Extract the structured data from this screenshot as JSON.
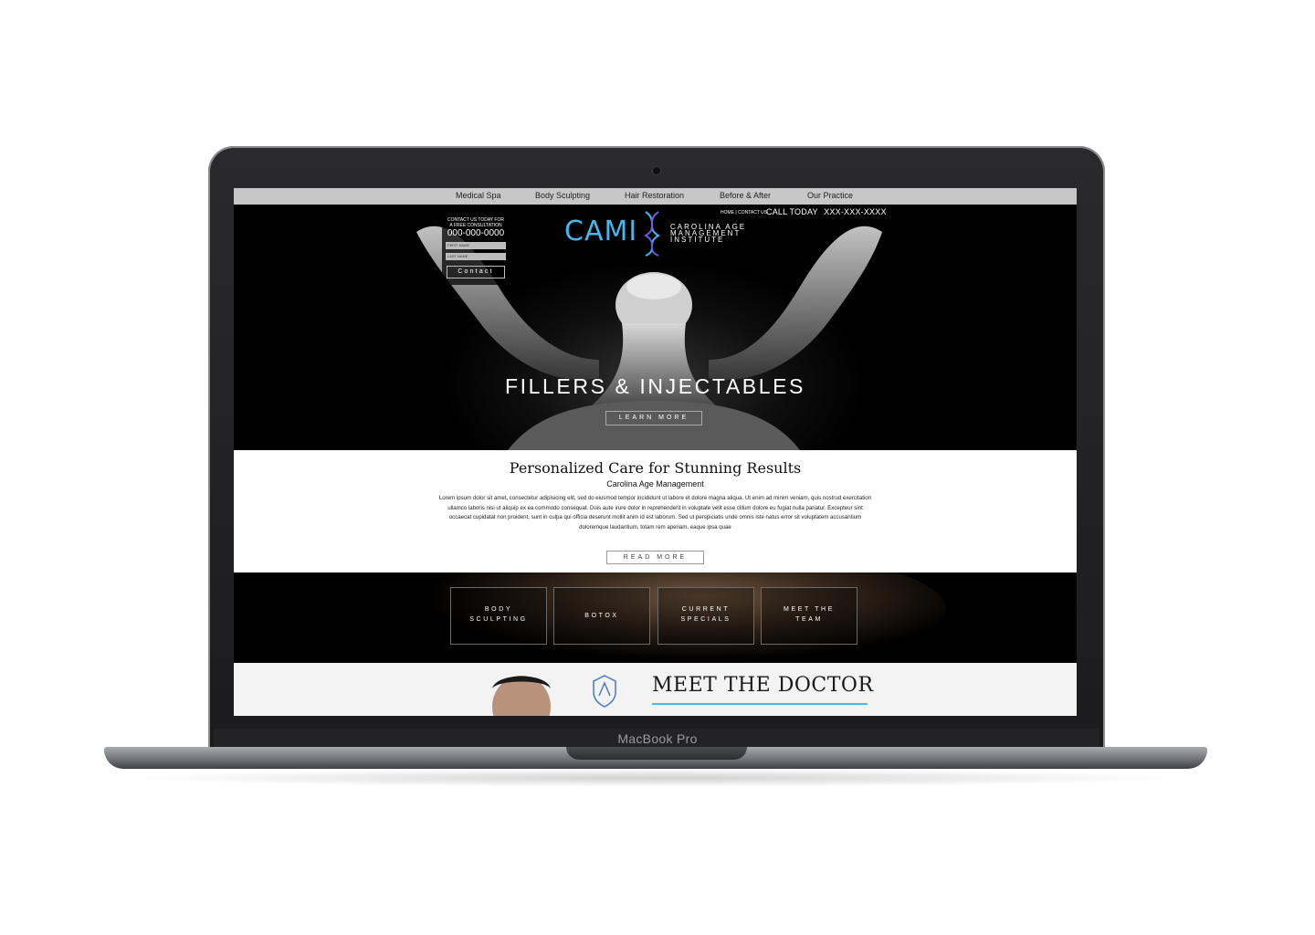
{
  "device": {
    "brand_label": "MacBook Pro"
  },
  "nav": {
    "items": [
      "Medical Spa",
      "Body Sculpting",
      "Hair Restoration",
      "Before & After",
      "Our Practice"
    ]
  },
  "header": {
    "top_links": "HOME | CONTACT US",
    "call_label": "CALL TODAY",
    "call_number": "XXX-XXX-XXXX"
  },
  "consult_form": {
    "line1": "CONTACT US TODAY FOR",
    "line2": "A FREE CONSULTATION",
    "phone": "000-000-0000",
    "first_name_placeholder": "FIRST NAME",
    "last_name_placeholder": "LAST NAME",
    "button": "Contact"
  },
  "logo": {
    "mark": "CAMI",
    "line1": "CAROLINA AGE",
    "line2": "MANAGEMENT",
    "line3": "INSTITUTE"
  },
  "hero": {
    "title": "FILLERS & INJECTABLES",
    "button": "LEARN MORE"
  },
  "care": {
    "title": "Personalized Care for Stunning Results",
    "subtitle": "Carolina Age Management",
    "body": "Lorem ipsum dolor sit amet, consectetur adipisicing elit, sed do eiusmod tempor incididunt ut labore et dolore magna aliqua. Ut enim ad minim veniam, quis nostrud exercitation ullamco laboris nisi ut aliquip ex ea commodo consequat. Duis aute irure dolor in reprehenderit in voluptate velit esse cillum dolore eu fugiat nulla pariatur. Excepteur sint occaecat cupidatat non proident, sunt in culpa qui officia deserunt mollit anim id est laborum. Sed ut perspiciatis unde omnis iste natus error sit voluptatem accusantium doloremque laudantium, totam rem aperiam, eaque ipsa quae",
    "button": "READ MORE"
  },
  "tiles": [
    {
      "line1": "BODY",
      "line2": "SCULPTING"
    },
    {
      "line1": "BOTOX",
      "line2": ""
    },
    {
      "line1": "CURRENT",
      "line2": "SPECIALS"
    },
    {
      "line1": "MEET THE",
      "line2": "TEAM"
    }
  ],
  "doctor": {
    "title": "MEET THE DOCTOR"
  },
  "colors": {
    "accent": "#43b8ee",
    "nav_bg": "#c7c7c7"
  }
}
